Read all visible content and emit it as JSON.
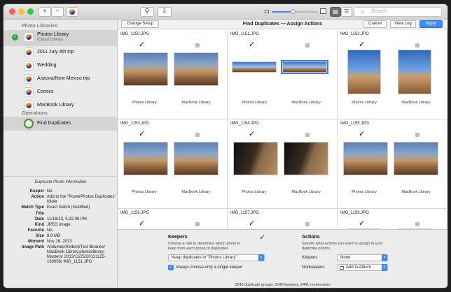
{
  "app": {
    "title": "Find Duplicates — Assign Actions",
    "search_placeholder": "Search"
  },
  "toolbar": {
    "change_setup": "Change Setup",
    "cancel": "Cancel",
    "view_log": "View Log",
    "apply": "Apply",
    "zoom_level": 0.45
  },
  "sidebar": {
    "section_libraries": "Photo Libraries",
    "section_operations": "Operations",
    "items": [
      {
        "label": "Photos Library",
        "sublabel": "iCloud Library"
      },
      {
        "label": "2011 July 4th trip"
      },
      {
        "label": "Wedding"
      },
      {
        "label": "Arizona/New Mexico trip"
      },
      {
        "label": "Comics"
      },
      {
        "label": "MacBook Library"
      }
    ],
    "operation": "Find Duplicates"
  },
  "info": {
    "title": "Duplicate Photo Information",
    "rows": [
      {
        "k": "Keeper",
        "v": "No"
      },
      {
        "k": "Action",
        "v": "Add to the \"PowerPhotos Duplicates\" folder"
      },
      {
        "k": "Match Type",
        "v": "Exact match (modified)"
      },
      {
        "k": "Title",
        "v": ""
      },
      {
        "k": "Date",
        "v": "11/16/13, 5:22:06 PM"
      },
      {
        "k": "Kind",
        "v": "JPEG image"
      },
      {
        "k": "Favorite",
        "v": "No"
      },
      {
        "k": "Size",
        "v": "8.8 MB"
      },
      {
        "k": "Moment",
        "v": "Nov 16, 2013"
      },
      {
        "k": "Image Path",
        "v": "/Volumes/Rotbert/Test libraries/ MacBook Library.photoslibrary/ Masters/ 2013/11/25/20131125-160058/ IMG_1151.JPG"
      }
    ]
  },
  "grid": {
    "library_a": "Photos Library",
    "library_b": "MacBook Library",
    "check": "✓",
    "cells": [
      {
        "name": "IMG_1150.JPG"
      },
      {
        "name": "IMG_1151.JPG"
      },
      {
        "name": "IMG_1152.JPG"
      },
      {
        "name": "IMG_1153.JPG"
      },
      {
        "name": "IMG_1154.JPG"
      },
      {
        "name": "IMG_1155.JPG"
      },
      {
        "name": "IMG_1156.JPG"
      },
      {
        "name": "IMG_1157.JPG"
      },
      {
        "name": "IMG_1158.JPG"
      }
    ]
  },
  "bottom": {
    "keepers_title": "Keepers",
    "keepers_desc": "Choose a rule to determine which photo to keep from each group of duplicates",
    "keepers_rule": "Keep duplicates in \"Photos Library\"",
    "single_keeper": "Always choose only a single keeper",
    "actions_title": "Actions",
    "actions_desc": "Specify what actions you want to assign to your duplicate photos",
    "keepers_label": "Keepers",
    "keepers_action": "None",
    "nonkeepers_label": "Nonkeepers",
    "nonkeepers_action": "Add to Album",
    "summary": "2243 duplicate groups, 2243 keepers, 2441 nonkeepers"
  }
}
